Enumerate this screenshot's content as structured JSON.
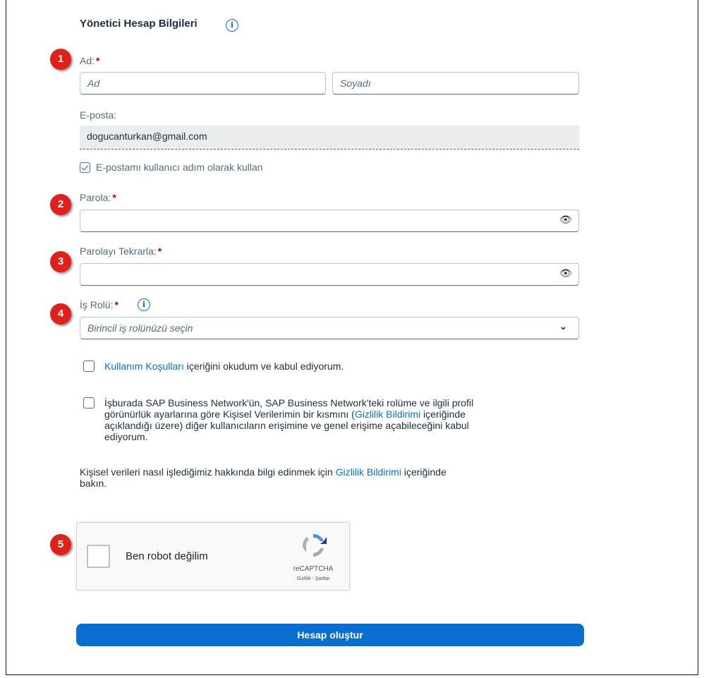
{
  "section": {
    "title": "Yönetici Hesap Bilgileri"
  },
  "badges": [
    "1",
    "2",
    "3",
    "4",
    "5"
  ],
  "required_mark": "*",
  "name": {
    "label": "Ad:",
    "first_placeholder": "Ad",
    "last_placeholder": "Soyadı"
  },
  "email": {
    "label": "E-posta:",
    "value": "dogucanturkan@gmail.com",
    "use_as_username_label": "E-postamı kullanıcı adım olarak kullan",
    "use_as_username_checked": true
  },
  "password": {
    "label": "Parola:"
  },
  "password_repeat": {
    "label": "Parolayı Tekrarla:"
  },
  "role": {
    "label": "İş Rolü:",
    "placeholder": "Birincil iş rolünüzü seçin"
  },
  "terms": {
    "link": "Kullanım Koşulları",
    "text": " içeriğini okudum ve kabul ediyorum."
  },
  "privacy_consent": {
    "line1": "İşburada SAP Business Network'ün, SAP Business Network'teki rolüme ve ilgili profil",
    "line2_prefix": "görünürlük ayarlarına göre Kişisel Verilerimin bir kısmını (",
    "line2_link": "Gizlilik Bildirimi",
    "line2_suffix": " içeriğinde",
    "line3": "açıklandığı üzere) diğer kullanıcıların erişimine ve genel erişime açabileceğini kabul",
    "line4": "ediyorum."
  },
  "privacy_info": {
    "prefix": "Kişisel verileri nasıl işlediğimiz hakkında bilgi edinmek için ",
    "link": "Gizlilik Bildirimi",
    "suffix": " içeriğinde",
    "line2": "bakın."
  },
  "captcha": {
    "label": "Ben robot değilim",
    "brand": "reCAPTCHA",
    "links": "Gizlilik - Şartlar"
  },
  "submit": {
    "label": "Hesap oluştur"
  },
  "colors": {
    "accent": "#0a6ed1",
    "badge": "#e0201b",
    "required": "#aa0808"
  }
}
